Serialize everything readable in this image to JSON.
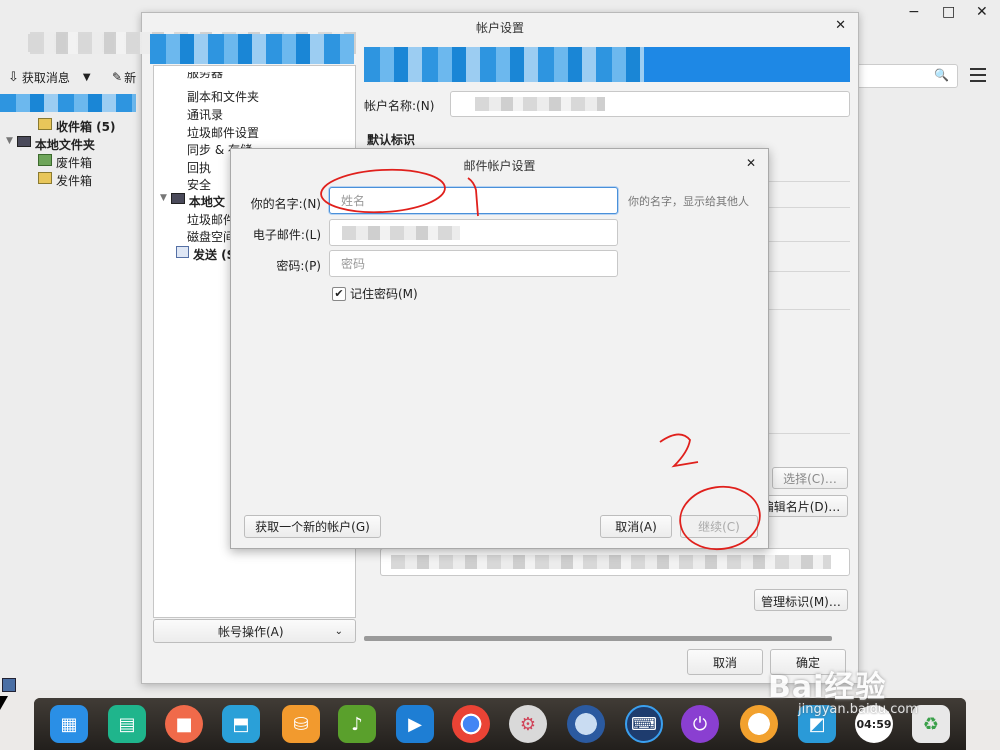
{
  "main_window": {
    "toolbar": {
      "get_messages": "获取消息",
      "new": "新"
    },
    "folders": {
      "inbox": "收件箱 (5)",
      "local_folders": "本地文件夹",
      "trash": "废件箱",
      "outbox": "发件箱"
    },
    "controls": {
      "minimize": "−",
      "maximize": "□",
      "close": "✕"
    }
  },
  "account_settings": {
    "title": "帐户设置",
    "close": "✕",
    "tree": {
      "cut_top": "服务器",
      "copies_folders": "副本和文件夹",
      "address_book": "通讯录",
      "junk_settings": "垃圾邮件设置",
      "sync_storage": "同步 & 存储",
      "receipts": "回执",
      "security": "安全",
      "local_prefix": "本地文",
      "junk_cut": "垃圾邮件",
      "disk_cut": "磁盘空间",
      "outgoing_cut": "发送 (S"
    },
    "account_name_label": "帐户名称:(N)",
    "default_identity": "默认标识",
    "choose_button": "选择(C)…",
    "edit_card_button": "编辑名片(D)…",
    "manage_identity_button": "管理标识(M)…",
    "account_actions": "帐号操作(A)",
    "cancel": "取消",
    "ok": "确定"
  },
  "mail_setup_dialog": {
    "title": "邮件帐户设置",
    "close": "✕",
    "name_label": "你的名字:(N)",
    "name_placeholder": "姓名",
    "name_hint": "你的名字，显示给其他人",
    "email_label": "电子邮件:(L)",
    "password_label": "密码:(P)",
    "password_placeholder": "密码",
    "remember_password": "记住密码(M)",
    "remember_checked": true,
    "get_new_account": "获取一个新的帐户(G)",
    "cancel": "取消(A)",
    "continue": "继续(C)"
  },
  "annotations": {
    "mark_1": "1",
    "mark_2": "2"
  },
  "watermark": {
    "brand": "Bai经验",
    "url": "jingyan.baidu.com"
  },
  "taskbar": {
    "clock": "04:59"
  },
  "colors": {
    "accent": "#1e88e5",
    "annotation_red": "#e0201c",
    "dock_bg": "#2d2a26"
  }
}
